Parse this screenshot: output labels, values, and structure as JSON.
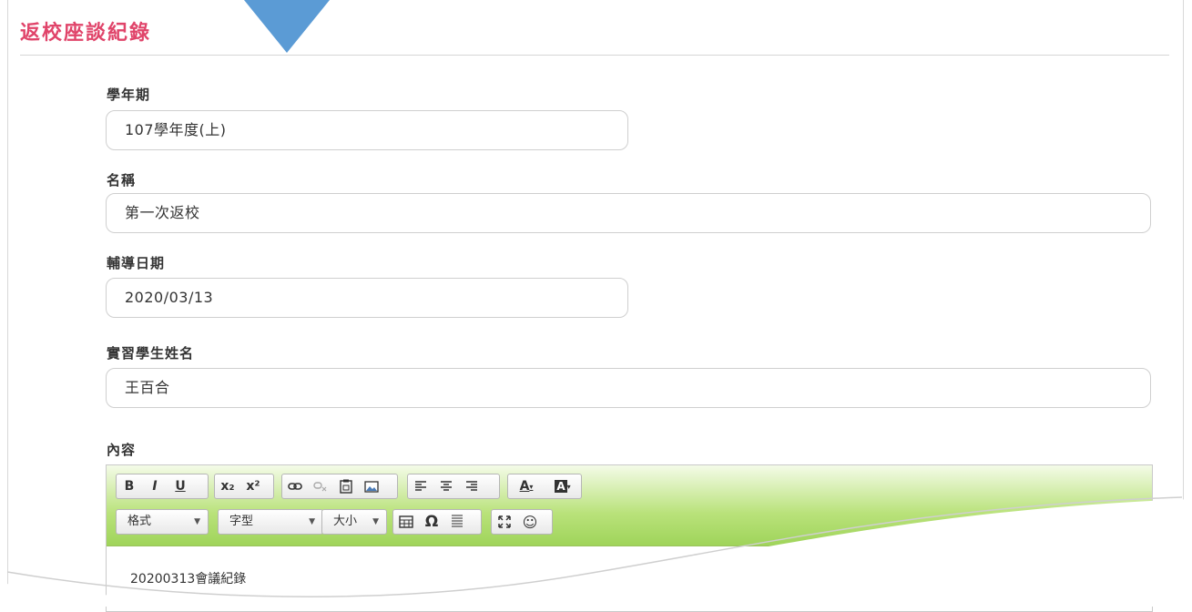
{
  "page": {
    "title": "返校座談紀錄"
  },
  "fields": {
    "semester": {
      "label": "學年期",
      "value": "107學年度(上)"
    },
    "name": {
      "label": "名稱",
      "value": "第一次返校"
    },
    "date": {
      "label": "輔導日期",
      "value": "2020/03/13"
    },
    "student": {
      "label": "實習學生姓名",
      "value": "王百合"
    },
    "content": {
      "label": "內容"
    }
  },
  "editor": {
    "toolbar": {
      "basic": [
        "B",
        "I",
        "U"
      ],
      "script": [
        "x₂",
        "x²"
      ],
      "links": [
        "link-icon",
        "unlink-icon",
        "paste-icon",
        "image-icon"
      ],
      "align": [
        "align-left-icon",
        "align-center-icon",
        "align-right-icon"
      ],
      "colors": [
        "A",
        "A"
      ],
      "format_label": "格式",
      "font_label": "字型",
      "size_label": "大小",
      "insert": [
        "table-icon",
        "omega-icon",
        "hr-icon"
      ],
      "extra": [
        "maximize-icon",
        "smiley-icon"
      ]
    },
    "body_text": "20200313會議紀錄"
  },
  "colors": {
    "title": "#e0446a",
    "tab_arrow": "#5b9bd5",
    "toolbar_green": "#9fd45a"
  }
}
